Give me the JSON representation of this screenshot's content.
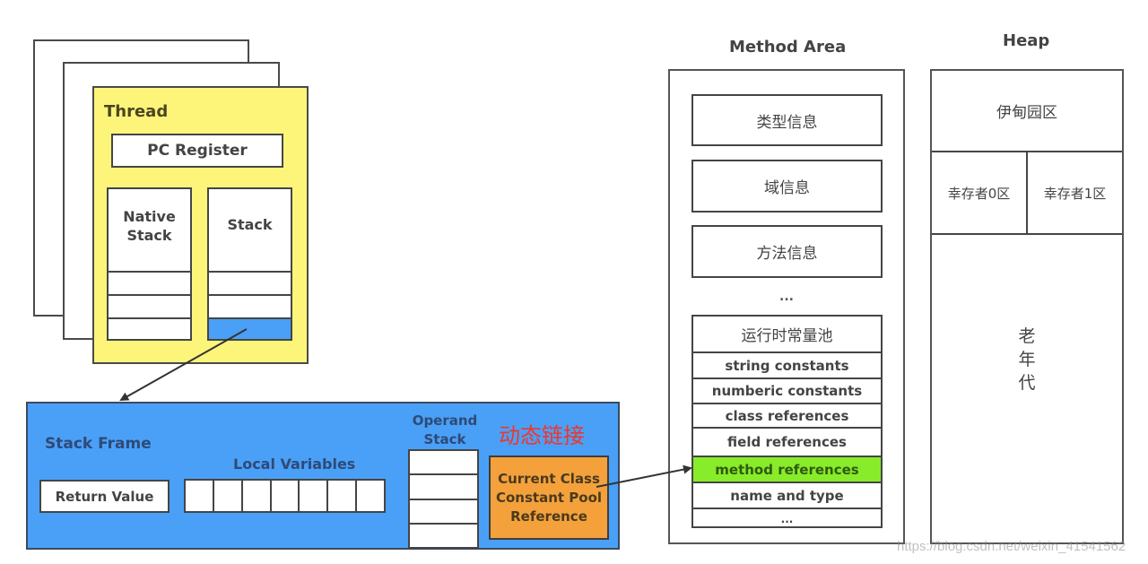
{
  "thread": {
    "title": "Thread",
    "pc_register": "PC Register",
    "native_stack": "Native\nStack",
    "stack": "Stack"
  },
  "stack_frame": {
    "title": "Stack Frame",
    "return_value": "Return Value",
    "local_variables": "Local Variables",
    "local_variable_slots": 7,
    "operand_stack": "Operand\nStack",
    "operand_stack_slots": 4,
    "dynamic_linking": "动态链接",
    "constant_pool_ref": "Current Class\nConstant Pool\nReference"
  },
  "method_area": {
    "title": "Method Area",
    "items": [
      "类型信息",
      "域信息",
      "方法信息"
    ],
    "ellipsis": "...",
    "runtime_constant_pool": {
      "title": "运行时常量池",
      "rows": [
        "string constants",
        "numberic constants",
        "class references",
        "field references",
        "method references",
        "name and type",
        "..."
      ],
      "highlighted_row": "method references"
    }
  },
  "heap": {
    "title": "Heap",
    "eden": "伊甸园区",
    "survivor0": "幸存者0区",
    "survivor1": "幸存者1区",
    "old_gen": "老\n年\n代"
  },
  "colors": {
    "thread_bg": "#fdf57a",
    "stack_frame_bg": "#4aa0f6",
    "constant_pool_ref_bg": "#f4a13c",
    "highlight_row_bg": "#88ec2a",
    "dynamic_linking_text": "#f2352b",
    "active_stack_slot": "#4aa0f6"
  },
  "watermark": "https://blog.csdn.net/weixin_41541562"
}
